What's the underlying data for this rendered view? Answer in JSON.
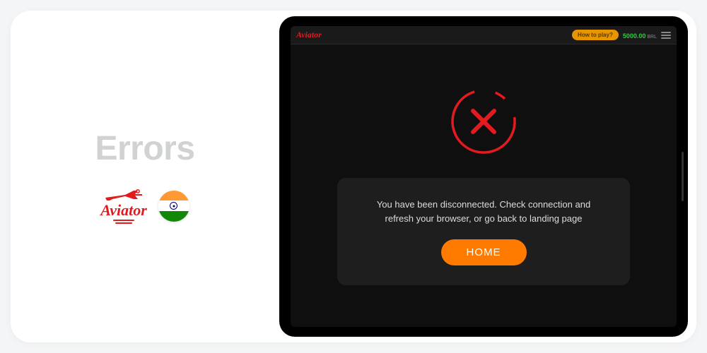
{
  "side": {
    "title": "Errors",
    "brand": "Aviator"
  },
  "app": {
    "brand": "Aviator",
    "header": {
      "how_to_play": "How to play?",
      "balance_amount": "5000.00",
      "balance_currency": "BRL"
    },
    "error": {
      "message": "You have been disconnected. Check connection and refresh your browser, or go back to landing page",
      "home_button": "HOME"
    }
  },
  "colors": {
    "accent_red": "#e31b1f",
    "accent_orange": "#ff7b00",
    "balance_green": "#2ecc40"
  }
}
